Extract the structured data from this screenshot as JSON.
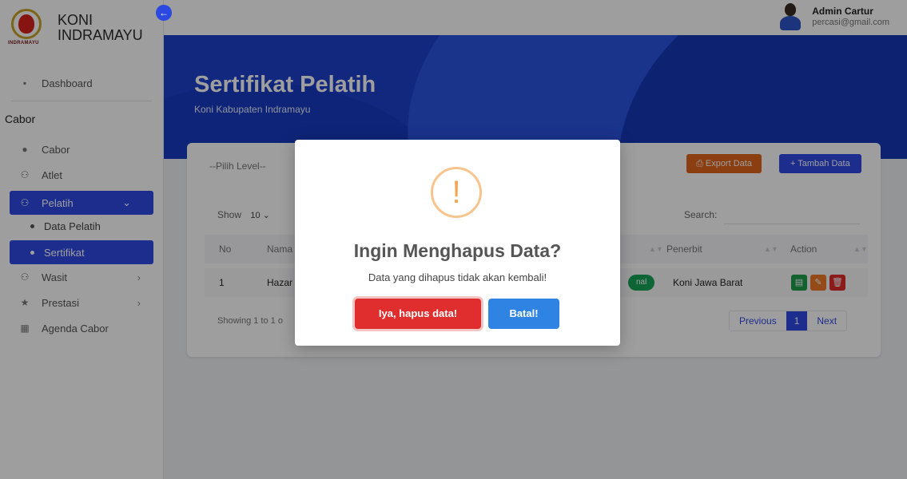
{
  "brand": {
    "line1": "KONI",
    "line2": "INDRAMAYU",
    "logo_text": "INDRAMAYU"
  },
  "sidebar": {
    "dashboard": "Dashboard",
    "section": "Cabor",
    "items": [
      {
        "label": "Cabor",
        "icon": "trophy-icon"
      },
      {
        "label": "Atlet",
        "icon": "users-icon"
      },
      {
        "label": "Pelatih",
        "icon": "users-icon"
      },
      {
        "label": "Wasit",
        "icon": "users-icon"
      },
      {
        "label": "Prestasi",
        "icon": "star-icon"
      },
      {
        "label": "Agenda Cabor",
        "icon": "calendar-icon"
      }
    ],
    "sub_items": [
      {
        "label": "Data Pelatih"
      },
      {
        "label": "Sertifikat"
      }
    ]
  },
  "user": {
    "name": "Admin Cartur",
    "email": "percasi@gmail.com"
  },
  "hero": {
    "title": "Sertifikat Pelatih",
    "subtitle": "Koni Kabupaten Indramayu"
  },
  "card": {
    "level_placeholder": "--Pilih Level--",
    "export_label": "Export Data",
    "add_label": "+ Tambah Data",
    "show_label": "Show",
    "show_value": "10",
    "search_label": "Search:",
    "columns": {
      "no": "No",
      "nama": "Nama",
      "penerbit": "Penerbit",
      "action": "Action"
    },
    "row": {
      "no": "1",
      "nama": "Hazar",
      "badge": "nal",
      "penerbit": "Koni Jawa Barat"
    },
    "showing": "Showing 1 to 1 o",
    "pager": {
      "prev": "Previous",
      "current": "1",
      "next": "Next"
    }
  },
  "modal": {
    "icon": "!",
    "title": "Ingin Menghapus Data?",
    "message": "Data yang dihapus tidak akan kembali!",
    "confirm": "Iya, hapus data!",
    "cancel": "Batal!"
  },
  "colors": {
    "primary": "#2f4ae6",
    "hero": "#1d3fcc",
    "danger": "#e02d2d",
    "warning": "#f5a551",
    "export": "#e0651a",
    "success": "#18a558"
  }
}
